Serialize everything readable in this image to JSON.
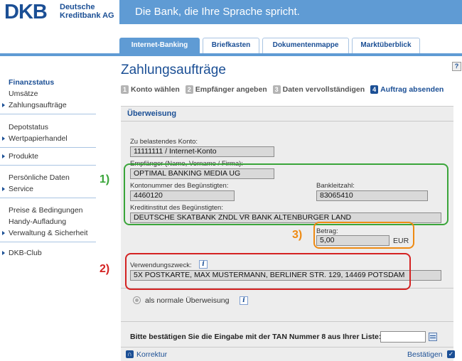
{
  "header": {
    "logo_text": "DKB",
    "logo_sub_line1": "Deutsche",
    "logo_sub_line2": "Kreditbank AG",
    "slogan": "Die Bank, die Ihre Sprache spricht.",
    "colors": {
      "brand": "#1b4f95",
      "banner": "#5f9bd4"
    }
  },
  "tabs": [
    {
      "label": "Internet-Banking",
      "active": true
    },
    {
      "label": "Briefkasten"
    },
    {
      "label": "Dokumentenmappe"
    },
    {
      "label": "Marktüberblick"
    }
  ],
  "sidebar": {
    "groups": [
      [
        "Finanzstatus",
        "Umsätze",
        "Zahlungsaufträge"
      ],
      [
        "Depotstatus",
        "Wertpapierhandel"
      ],
      [
        "Produkte"
      ],
      [
        "Persönliche Daten",
        "Service"
      ],
      [
        "Preise & Bedingungen",
        "Handy-Aufladung",
        "Verwaltung & Sicherheit"
      ],
      [
        "DKB-Club"
      ]
    ]
  },
  "page": {
    "title": "Zahlungsaufträge",
    "help_icon": "?",
    "steps": [
      {
        "num": "1",
        "label": "Konto wählen"
      },
      {
        "num": "2",
        "label": "Empfänger angeben"
      },
      {
        "num": "3",
        "label": "Daten vervollständigen"
      },
      {
        "num": "4",
        "label": "Auftrag absenden"
      }
    ]
  },
  "form": {
    "title": "Überweisung",
    "konto_label": "Zu belastendes Konto:",
    "konto_value": "11111111 / Internet-Konto",
    "empfaenger_label": "Empfänger (Name, Vorname / Firma):",
    "empfaenger_value": "OPTIMAL BANKING MEDIA UG",
    "kontonummer_label": "Kontonummer des Begünstigten:",
    "kontonummer_value": "4460120",
    "blz_label": "Bankleitzahl:",
    "blz_value": "83065410",
    "institut_label": "Kreditinstitut des Begünstigten:",
    "institut_value": "DEUTSCHE SKATBANK ZNDL VR BANK ALTENBURGER LAND",
    "betrag_label": "Betrag:",
    "betrag_value": "5,00",
    "currency": "EUR",
    "zweck_label": "Verwendungszweck:",
    "zweck_value": "5X POSTKARTE, MAX MUSTERMANN, BERLINER STR. 129, 14469 POTSDAM",
    "option_label": "als normale Überweisung",
    "tan_label": "Bitte bestätigen Sie die Eingabe mit der TAN Nummer 8 aus Ihrer Liste:",
    "tan_value": "",
    "back_label": "Korrektur",
    "confirm_label": "Bestätigen"
  },
  "annotations": [
    {
      "label": "1)",
      "color": "#3aa53a"
    },
    {
      "label": "2)",
      "color": "#d42222"
    },
    {
      "label": "3)",
      "color": "#ee8a12"
    }
  ]
}
